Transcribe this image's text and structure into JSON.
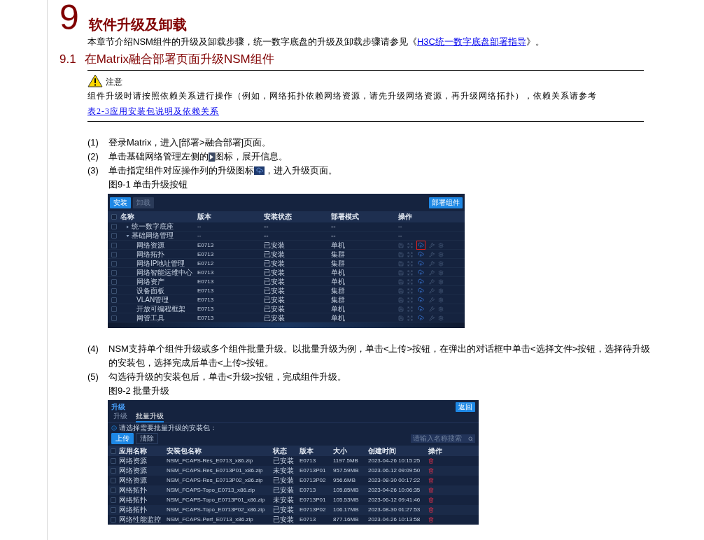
{
  "chapter": {
    "number": "9",
    "title": "软件升级及卸载"
  },
  "intro": {
    "text": "本章节介绍NSM组件的升级及卸载步骤，统一数字底盘的升级及卸载步骤请参见《",
    "link": "H3C统一数字底盘部署指导",
    "after": "》。"
  },
  "section": {
    "number": "9.1",
    "title": "在Matrix融合部署页面升级NSM组件"
  },
  "note": {
    "label": "注意",
    "text": "组件升级时请按照依赖关系进行操作（例如，网络拓扑依赖网络资源，请先升级网络资源，再升级网络拓扑），依赖关系请参考",
    "link": "表2-3应用安装包说明及依赖关系"
  },
  "blocks": [
    {
      "kind": "step",
      "number": "(1)",
      "parts": [
        {
          "kind": "text",
          "text": "登录Matrix，进入[部署>融合部署]页面。"
        }
      ]
    },
    {
      "kind": "step",
      "number": "(2)",
      "parts": [
        {
          "kind": "text",
          "text": "单击基础网络管理左侧的"
        },
        {
          "kind": "caret"
        },
        {
          "kind": "text",
          "text": "图标，展开信息。"
        }
      ]
    },
    {
      "kind": "step",
      "number": "(3)",
      "parts": [
        {
          "kind": "text",
          "text": "单击指定组件对应操作列的升级图标"
        },
        {
          "kind": "upload"
        },
        {
          "kind": "text",
          "text": "，进入升级页面。"
        }
      ]
    },
    {
      "kind": "caption",
      "text": "图9-1 单击升级按钮"
    },
    {
      "kind": "components_screen",
      "buttons": [
        {
          "label": "安装",
          "disabled": false
        },
        {
          "label": "卸载",
          "disabled": true
        }
      ],
      "deploy_button": "部署组件",
      "select_all_checked": false,
      "columns": [
        "名称",
        "版本",
        "安装状态",
        "部署模式",
        "操作"
      ],
      "rows": [
        {
          "name": "统一数字底座",
          "version": "--",
          "status": "--",
          "mode": "--",
          "actions": "--",
          "checked": false,
          "expanded": false
        },
        {
          "name": "基础网络管理",
          "version": "--",
          "status": "--",
          "mode": "--",
          "actions": "--",
          "checked": false,
          "expanded": true,
          "children": [
            {
              "name": "网络资源",
              "version": "E0713",
              "status": "已安装",
              "mode": "单机",
              "checked": false,
              "highlighted": true
            },
            {
              "name": "网络拓扑",
              "version": "E0713",
              "status": "已安装",
              "mode": "集群",
              "checked": false,
              "highlighted": false
            },
            {
              "name": "网络IP地址管理",
              "version": "E0712",
              "status": "已安装",
              "mode": "集群",
              "checked": false,
              "highlighted": false
            },
            {
              "name": "网络智能运维中心",
              "version": "E0713",
              "status": "已安装",
              "mode": "单机",
              "checked": false,
              "highlighted": false
            },
            {
              "name": "网络资产",
              "version": "E0713",
              "status": "已安装",
              "mode": "单机",
              "checked": false,
              "highlighted": false
            },
            {
              "name": "设备面板",
              "version": "E0713",
              "status": "已安装",
              "mode": "集群",
              "checked": false,
              "highlighted": false
            },
            {
              "name": "VLAN管理",
              "version": "E0713",
              "status": "已安装",
              "mode": "集群",
              "checked": false,
              "highlighted": false
            },
            {
              "name": "开放可编程框架",
              "version": "E0713",
              "status": "已安装",
              "mode": "单机",
              "checked": false,
              "highlighted": false
            },
            {
              "name": "网管工具",
              "version": "E0713",
              "status": "已安装",
              "mode": "单机",
              "checked": false,
              "highlighted": false
            }
          ]
        }
      ]
    },
    {
      "kind": "step",
      "number": "(4)",
      "parts": [
        {
          "kind": "text",
          "text": "NSM支持单个组件升级或多个组件批量升级。以批量升级为例，单击<上传>按钮，在弹出的对话框中单击<选择文件>按钮，选择待升级的安装包，选择完成后单击<上传>按钮。"
        }
      ]
    },
    {
      "kind": "step",
      "number": "(5)",
      "parts": [
        {
          "kind": "text",
          "text": "勾选待升级的安装包后，单击<升级>按钮，完成组件升级。"
        }
      ]
    },
    {
      "kind": "caption",
      "text": "图9-2 批量升级"
    },
    {
      "kind": "upgrade_screen",
      "title": "升级",
      "back_button": "返回",
      "tabs": [
        {
          "label": "升级",
          "selected": false
        },
        {
          "label": "批量升级",
          "selected": true
        }
      ],
      "hint": "请选择需要批量升级的安装包：",
      "buttons": [
        {
          "label": "上传",
          "primary": true
        },
        {
          "label": "清除",
          "primary": false
        }
      ],
      "search": {
        "placeholder": "请输入名称搜索"
      },
      "select_all_checked": false,
      "columns": [
        "应用名称",
        "安装包名称",
        "状态",
        "版本",
        "大小",
        "创建时间",
        "操作"
      ],
      "rows": [
        {
          "app": "网络资源",
          "package": "NSM_FCAPS-Res_E0713_x86.zip",
          "status": "已安装",
          "version": "E0713",
          "size": "1197.5MB",
          "created": "2023-04-26 10:15:25",
          "checked": false
        },
        {
          "app": "网络资源",
          "package": "NSM_FCAPS-Res_E0713P01_x86.zip",
          "status": "未安装",
          "version": "E0713P01",
          "size": "957.59MB",
          "created": "2023-06-12 09:09:50",
          "checked": false
        },
        {
          "app": "网络资源",
          "package": "NSM_FCAPS-Res_E0713P02_x86.zip",
          "status": "已安装",
          "version": "E0713P02",
          "size": "956.6MB",
          "created": "2023-08-30 00:17:22",
          "checked": false
        },
        {
          "app": "网络拓扑",
          "package": "NSM_FCAPS-Topo_E0713_x86.zip",
          "status": "已安装",
          "version": "E0713",
          "size": "105.85MB",
          "created": "2023-04-26 10:06:35",
          "checked": false
        },
        {
          "app": "网络拓扑",
          "package": "NSM_FCAPS-Topo_E0713P01_x86.zip",
          "status": "未安装",
          "version": "E0713P01",
          "size": "105.53MB",
          "created": "2023-06-12 09:41:46",
          "checked": false
        },
        {
          "app": "网络拓扑",
          "package": "NSM_FCAPS-Topo_E0713P02_x86.zip",
          "status": "已安装",
          "version": "E0713P02",
          "size": "106.17MB",
          "created": "2023-08-30 01:27:53",
          "checked": false
        },
        {
          "app": "网络性能监控",
          "package": "NSM_FCAPS-Perf_E0713_x86.zip",
          "status": "已安装",
          "version": "E0713",
          "size": "877.16MB",
          "created": "2023-04-26 10:13:58",
          "checked": false
        }
      ]
    }
  ]
}
